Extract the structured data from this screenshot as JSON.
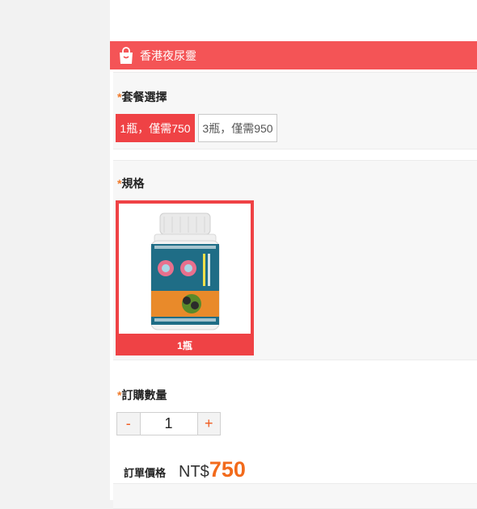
{
  "header": {
    "title": "香港夜尿靈",
    "icon": "shopping-bag-icon"
  },
  "package": {
    "required_mark": "*",
    "label": "套餐選擇",
    "options": [
      {
        "label": "1瓶，僅需750",
        "selected": true
      },
      {
        "label": "3瓶，僅需950",
        "selected": false
      }
    ]
  },
  "spec": {
    "required_mark": "*",
    "label": "規格",
    "options": [
      {
        "caption": "1瓶",
        "selected": true
      }
    ]
  },
  "quantity": {
    "required_mark": "*",
    "label": "訂購數量",
    "minus": "-",
    "plus": "+",
    "value": "1"
  },
  "price": {
    "label": "訂單價格",
    "currency": "NT$",
    "value": "750"
  },
  "colors": {
    "accent_red": "#ef4245",
    "header_red": "#f45456",
    "price_orange": "#f26a1b",
    "required_orange": "#f07a2a"
  }
}
